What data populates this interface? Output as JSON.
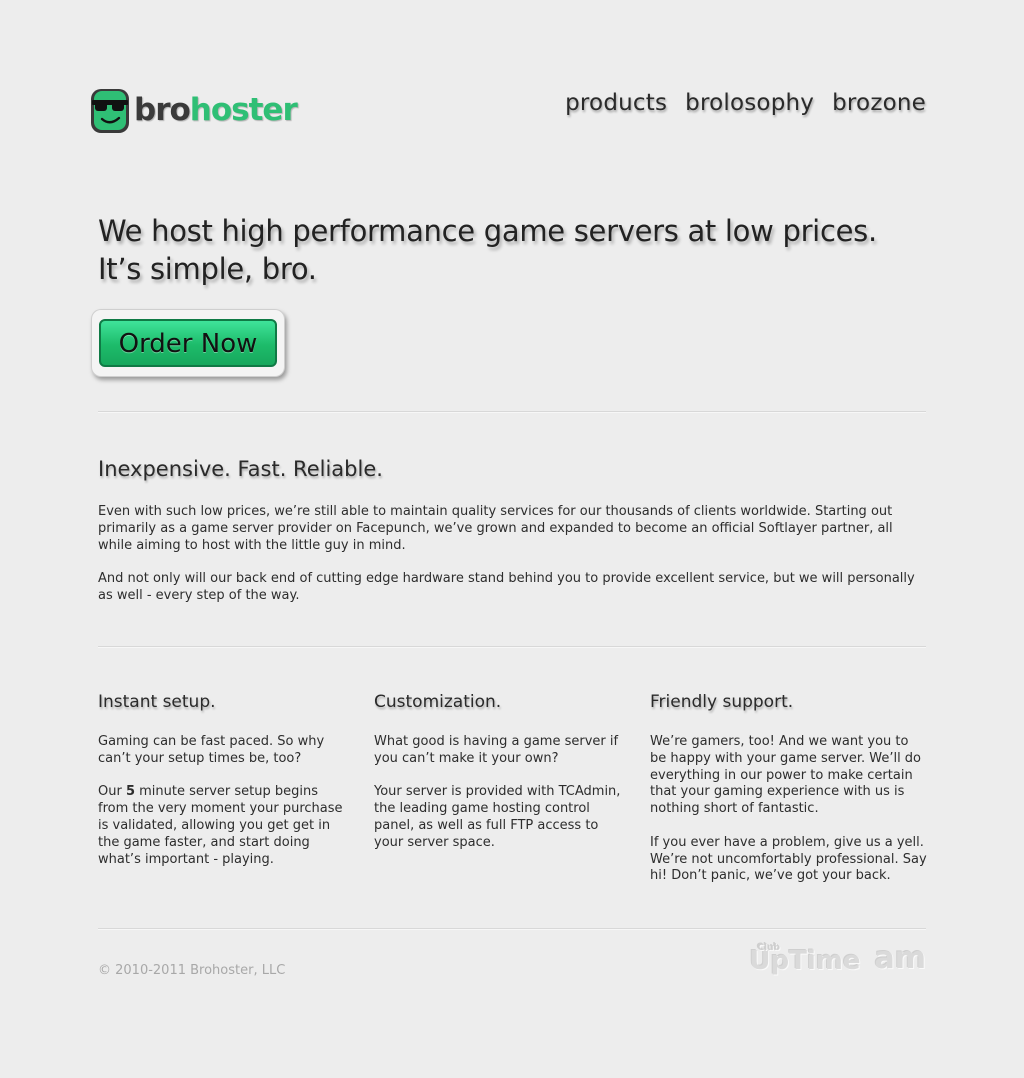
{
  "header": {
    "logo": {
      "bro": "bro",
      "host": "hoster"
    },
    "nav": [
      "products",
      "brolosophy",
      "brozone"
    ]
  },
  "hero": {
    "line1": "We host high performance game servers at low prices.",
    "line2": "It’s simple, bro.",
    "order_label": "Order Now"
  },
  "about": {
    "heading": "Inexpensive. Fast. Reliable.",
    "p1": "Even with such low prices, we’re still able to maintain quality services for our thousands of clients worldwide. Starting out primarily as a game server provider on Facepunch, we’ve grown and expanded to become an official Softlayer partner, all while aiming to host with the little guy in mind.",
    "p2": "And not only will our back end of cutting edge hardware stand behind you to provide excellent service, but we will personally as well - every step of the way."
  },
  "features": [
    {
      "title": "Instant setup.",
      "p1": "Gaming can be fast paced. So why can’t your setup times be, too?",
      "p2_pre": "Our ",
      "p2_bold": "5",
      "p2_post": " minute server setup begins from the very moment your purchase is validated, allowing you get get in the game faster, and start doing what’s important - playing."
    },
    {
      "title": "Customization.",
      "p1": "What good is having a game server if you can’t make it your own?",
      "p2": "Your server is provided with TCAdmin, the leading game hosting control panel, as well as full FTP access to your server space."
    },
    {
      "title": "Friendly support.",
      "p1": "We’re gamers, too! And we want you to be happy with your game server. We’ll do everything in our power to make certain that your gaming experience with us is nothing short of fantastic.",
      "p2": "If you ever have a problem, give us a yell. We’re not uncomfortably professional. Say hi! Don’t panic, we’ve got your back."
    }
  ],
  "footer": {
    "copyright": "© 2010-2011 Brohoster, LLC",
    "uptime_club": "Club",
    "uptime": "UpTime",
    "am": "am"
  },
  "colors": {
    "background": "#ededed",
    "brand_green": "#2fbf75",
    "button_green": "#1dbb6a"
  }
}
